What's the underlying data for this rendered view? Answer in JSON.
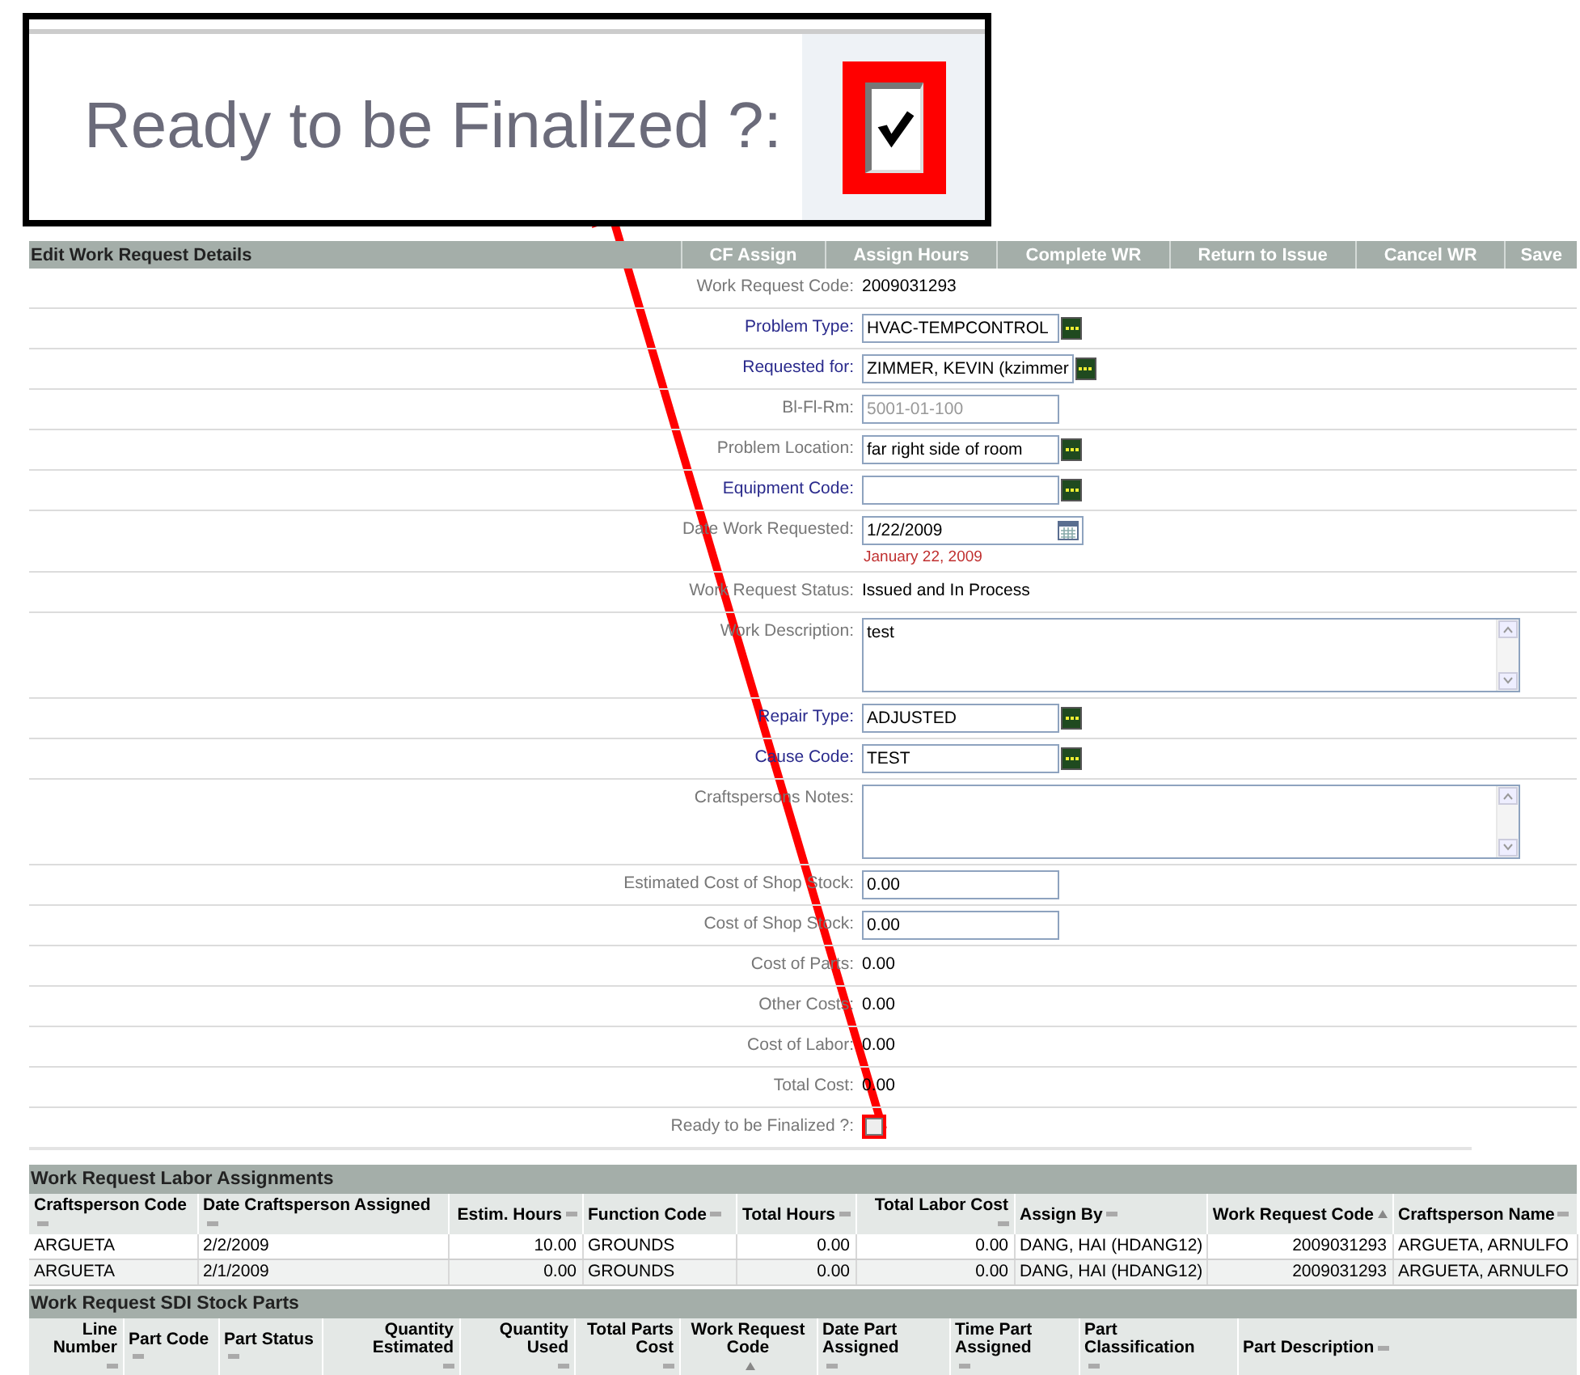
{
  "callout": {
    "label": "Ready to be Finalized ?:",
    "checked": true
  },
  "toolbar": {
    "title": "Edit Work Request Details",
    "buttons": [
      "CF Assign",
      "Assign Hours",
      "Complete WR",
      "Return to Issue",
      "Cancel WR",
      "Save"
    ]
  },
  "form": {
    "fields": [
      {
        "label": "Work Request Code:",
        "link": false,
        "kind": "text",
        "value": "2009031293"
      },
      {
        "label": "Problem Type:",
        "link": true,
        "kind": "lookup",
        "value": "HVAC-TEMPCONTROL"
      },
      {
        "label": "Requested for:",
        "link": true,
        "kind": "lookup",
        "value": "ZIMMER, KEVIN (kzimmer"
      },
      {
        "label": "Bl-Fl-Rm:",
        "link": false,
        "kind": "input",
        "value": "5001-01-100",
        "disabled": true
      },
      {
        "label": "Problem Location:",
        "link": false,
        "kind": "lookup",
        "value": "far right side of room"
      },
      {
        "label": "Equipment Code:",
        "link": true,
        "kind": "lookup"
      },
      {
        "label": "Date Work Requested:",
        "link": false,
        "kind": "date",
        "value": "1/22/2009",
        "note": "January 22, 2009"
      },
      {
        "label": "Work Request Status:",
        "link": false,
        "kind": "text",
        "value": "Issued and In Process"
      },
      {
        "label": "Work Description:",
        "link": false,
        "kind": "textarea",
        "value": "test"
      },
      {
        "label": "Repair Type:",
        "link": true,
        "kind": "lookup",
        "value": "ADJUSTED"
      },
      {
        "label": "Cause Code:",
        "link": true,
        "kind": "lookup",
        "value": "TEST"
      },
      {
        "label": "Craftspersons Notes:",
        "link": false,
        "kind": "textarea"
      },
      {
        "label": "Estimated Cost of Shop Stock:",
        "link": false,
        "kind": "input",
        "value": "0.00",
        "disabled": false
      },
      {
        "label": "Cost of Shop Stock:",
        "link": false,
        "kind": "input",
        "value": "0.00",
        "disabled": false
      },
      {
        "label": "Cost of Parts:",
        "link": false,
        "kind": "text",
        "value": "0.00"
      },
      {
        "label": "Other Costs:",
        "link": false,
        "kind": "text",
        "value": "0.00"
      },
      {
        "label": "Cost of Labor:",
        "link": false,
        "kind": "text",
        "value": "0.00"
      },
      {
        "label": "Total Cost:",
        "link": false,
        "kind": "text",
        "value": "0.00"
      },
      {
        "label": "Ready to be Finalized ?:",
        "link": false,
        "kind": "checkbox",
        "checked": false,
        "highlighted": true
      }
    ]
  },
  "labor": {
    "title": "Work Request Labor Assignments",
    "columns": [
      {
        "label": "Craftsperson Code",
        "kind": "text",
        "sorted": false
      },
      {
        "label": "Date Craftsperson Assigned",
        "kind": "text",
        "sorted": false
      },
      {
        "label": "Estim. Hours",
        "kind": "number",
        "sorted": false
      },
      {
        "label": "Function Code",
        "kind": "text",
        "sorted": false
      },
      {
        "label": "Total Hours",
        "kind": "number",
        "sorted": false
      },
      {
        "label": "Total Labor Cost",
        "kind": "number",
        "sorted": false
      },
      {
        "label": "Assign By",
        "kind": "text",
        "sorted": false
      },
      {
        "label": "Work Request Code",
        "kind": "number",
        "sorted": true
      },
      {
        "label": "Craftsperson Name",
        "kind": "text",
        "sorted": false
      }
    ],
    "rows": [
      [
        "ARGUETA",
        "2/2/2009",
        "10.00",
        "GROUNDS",
        "0.00",
        "0.00",
        "DANG, HAI (HDANG12)",
        "2009031293",
        "ARGUETA, ARNULFO"
      ],
      [
        "ARGUETA",
        "2/1/2009",
        "0.00",
        "GROUNDS",
        "0.00",
        "0.00",
        "DANG, HAI (HDANG12)",
        "2009031293",
        "ARGUETA, ARNULFO"
      ]
    ]
  },
  "parts": {
    "title": "Work Request SDI Stock Parts",
    "columns": [
      {
        "label": "Line Number",
        "kind": "number",
        "sorted": false
      },
      {
        "label": "Part Code",
        "kind": "text",
        "sorted": false
      },
      {
        "label": "Part Status",
        "kind": "text",
        "sorted": false
      },
      {
        "label": "Quantity Estimated",
        "kind": "number",
        "sorted": false
      },
      {
        "label": "Quantity Used",
        "kind": "number",
        "sorted": false
      },
      {
        "label": "Total Parts Cost",
        "kind": "number",
        "sorted": false
      },
      {
        "label": "Work Request Code",
        "kind": "center",
        "sorted": true
      },
      {
        "label": "Date Part Assigned",
        "kind": "text",
        "sorted": false
      },
      {
        "label": "Time Part Assigned",
        "kind": "text",
        "sorted": false
      },
      {
        "label": "Part Classification",
        "kind": "text",
        "sorted": false
      },
      {
        "label": "Part Description",
        "kind": "text",
        "sorted": false
      }
    ]
  }
}
